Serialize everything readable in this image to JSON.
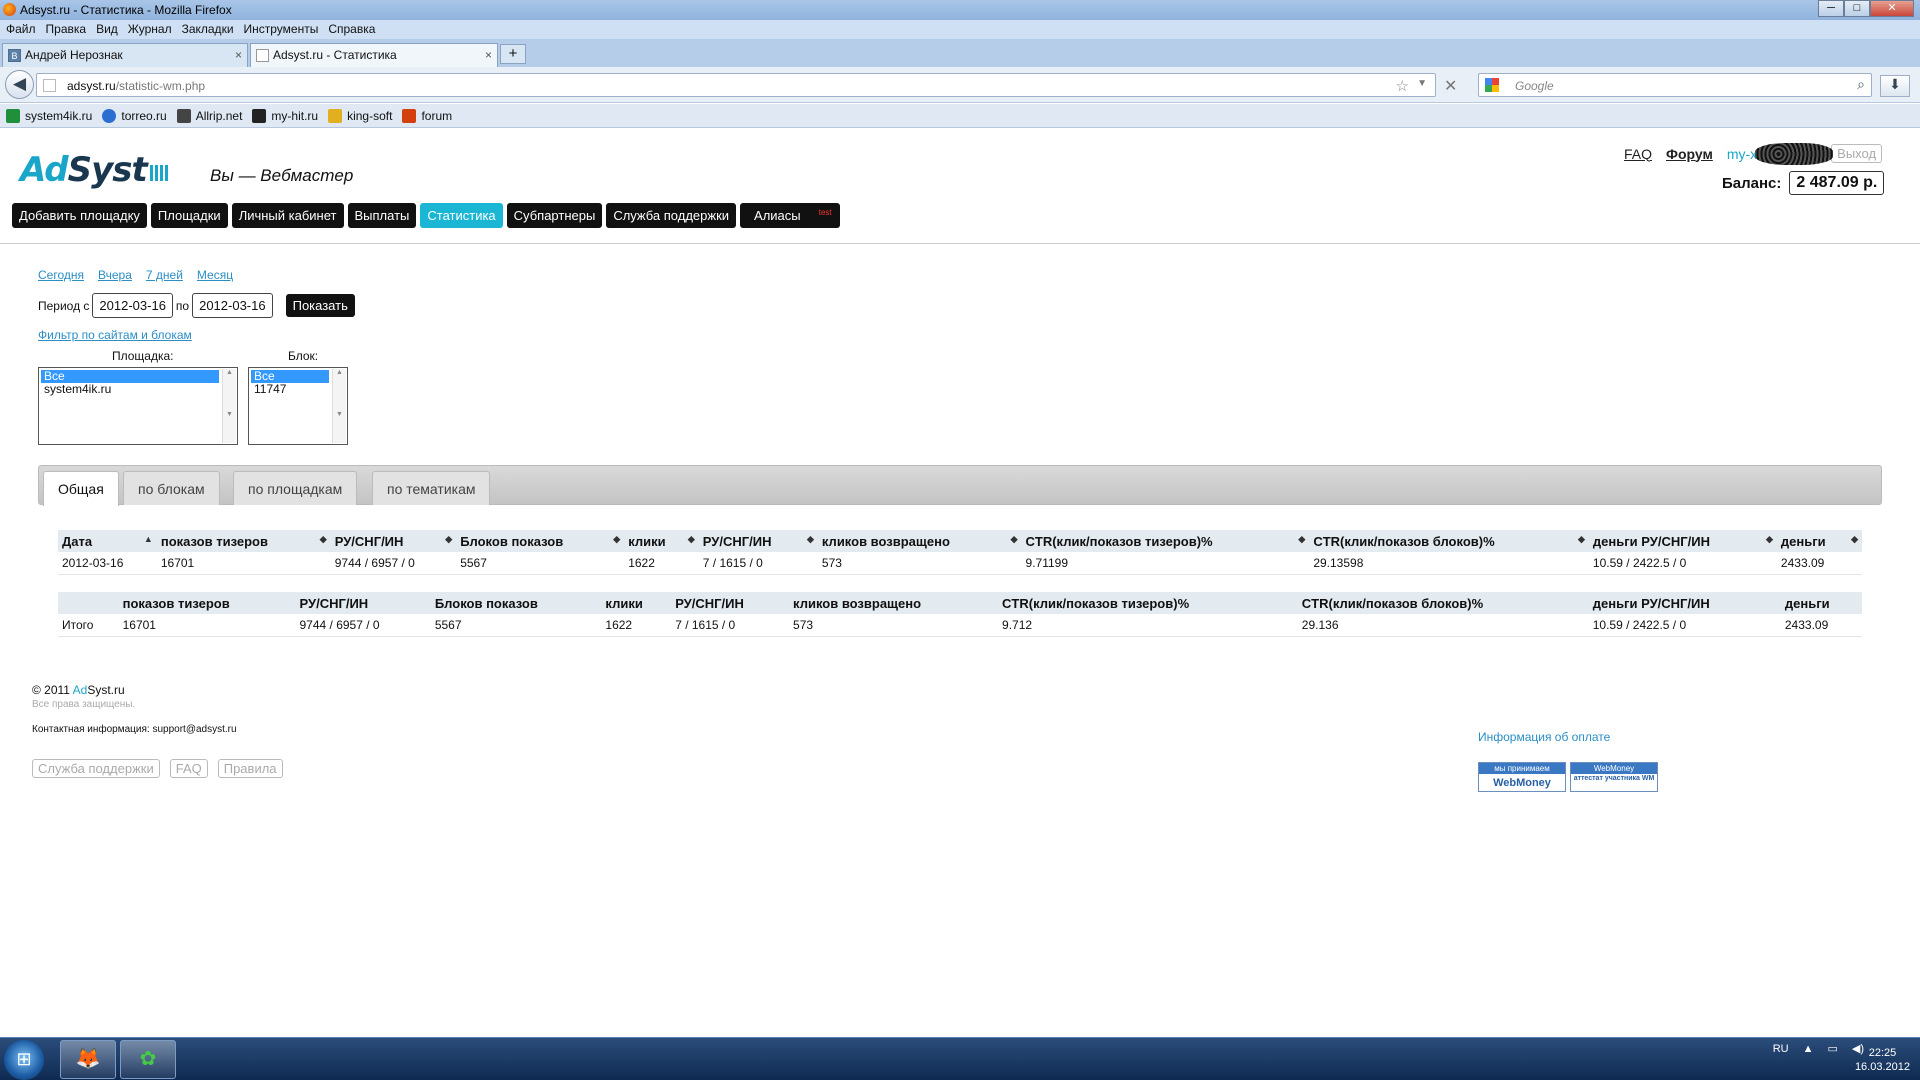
{
  "window": {
    "title": "Adsyst.ru - Статистика - Mozilla Firefox"
  },
  "menubar": [
    "Файл",
    "Правка",
    "Вид",
    "Журнал",
    "Закладки",
    "Инструменты",
    "Справка"
  ],
  "tabs": [
    {
      "label": "Андрей Нерознак",
      "close": "×"
    },
    {
      "label": "Adsyst.ru - Статистика",
      "close": "×"
    }
  ],
  "newtab": "+",
  "url": {
    "host": "adsyst.ru",
    "path": "/statistic-wm.php"
  },
  "search": {
    "placeholder": "Google"
  },
  "bookmarks": [
    {
      "label": "system4ik.ru",
      "color": "#1f8f3a"
    },
    {
      "label": "torreo.ru",
      "color": "#2a6fd0"
    },
    {
      "label": "Allrip.net",
      "color": "#444444"
    },
    {
      "label": "my-hit.ru",
      "color": "#222222"
    },
    {
      "label": "king-soft",
      "color": "#e0b020"
    },
    {
      "label": "forum",
      "color": "#d24010"
    }
  ],
  "site": {
    "logo": {
      "ad": "Ad",
      "syst": "Syst"
    },
    "slogan": "Вы — Вебмастер",
    "faq": "FAQ",
    "forum": "Форум",
    "user": "my-x",
    "exit": "Выход",
    "balance_label": "Баланс:",
    "balance_value": "2 487.09 р.",
    "menu": [
      {
        "label": "Добавить площадку"
      },
      {
        "label": "Площадки"
      },
      {
        "label": "Личный кабинет"
      },
      {
        "label": "Выплаты"
      },
      {
        "label": "Статистика"
      },
      {
        "label": "Субпартнеры"
      },
      {
        "label": "Служба поддержки"
      },
      {
        "label": "Алиасы",
        "badge": "test"
      }
    ]
  },
  "filters": {
    "quick": [
      "Сегодня",
      "Вчера",
      "7 дней",
      "Месяц"
    ],
    "period_from_label": "Период с",
    "period_to_label": "по",
    "date_from": "2012-03-16",
    "date_to": "2012-03-16",
    "show": "Показать",
    "filter_link": "Фильтр по сайтам и блокам",
    "site_label": "Площадка:",
    "site_options": [
      "Все",
      "system4ik.ru"
    ],
    "block_label": "Блок:",
    "block_options": [
      "Все",
      "11747"
    ]
  },
  "stat_tabs": [
    "Общая",
    "по блокам",
    "по площадкам",
    "по тематикам"
  ],
  "table1": {
    "headers": [
      "Дата",
      "показов тизеров",
      "РУ/СНГ/ИН",
      "Блоков показов",
      "клики",
      "РУ/СНГ/ИН",
      "кликов возвращено",
      "CTR(клик/показов тизеров)%",
      "CTR(клик/показов блоков)%",
      "деньги РУ/СНГ/ИН",
      "деньги"
    ],
    "sort_up": "▲",
    "sort_both": "◆",
    "rows": [
      [
        "2012-03-16",
        "16701",
        "9744 / 6957 / 0",
        "5567",
        "1622",
        "7 / 1615 / 0",
        "573",
        "9.71199",
        "29.13598",
        "10.59 / 2422.5 / 0",
        "2433.09"
      ]
    ]
  },
  "table2": {
    "headers": [
      "",
      "показов тизеров",
      "РУ/СНГ/ИН",
      "Блоков показов",
      "клики",
      "РУ/СНГ/ИН",
      "кликов возвращено",
      "CTR(клик/показов тизеров)%",
      "CTR(клик/показов блоков)%",
      "деньги РУ/СНГ/ИН",
      "деньги"
    ],
    "rows": [
      [
        "Итого",
        "16701",
        "9744 / 6957 / 0",
        "5567",
        "1622",
        "7 / 1615 / 0",
        "573",
        "9.712",
        "29.136",
        "10.59 / 2422.5 / 0",
        "2433.09"
      ]
    ]
  },
  "footer": {
    "copy": "© 2011 ",
    "brand_ad": "Ad",
    "brand_rest": "Syst.ru",
    "rights": "Все права защищены.",
    "contact": "Контактная информация: support@adsyst.ru",
    "buttons": [
      "Служба поддержки",
      "FAQ",
      "Правила"
    ],
    "pay_info": "Информация об оплате",
    "wm1_top": "мы принимаем",
    "wm1_bot": "WebMoney",
    "wm2_top": "WebMoney",
    "wm2_bot": "аттестат участника WM"
  },
  "taskbar": {
    "lang": "RU",
    "time": "22:25",
    "date": "16.03.2012"
  }
}
